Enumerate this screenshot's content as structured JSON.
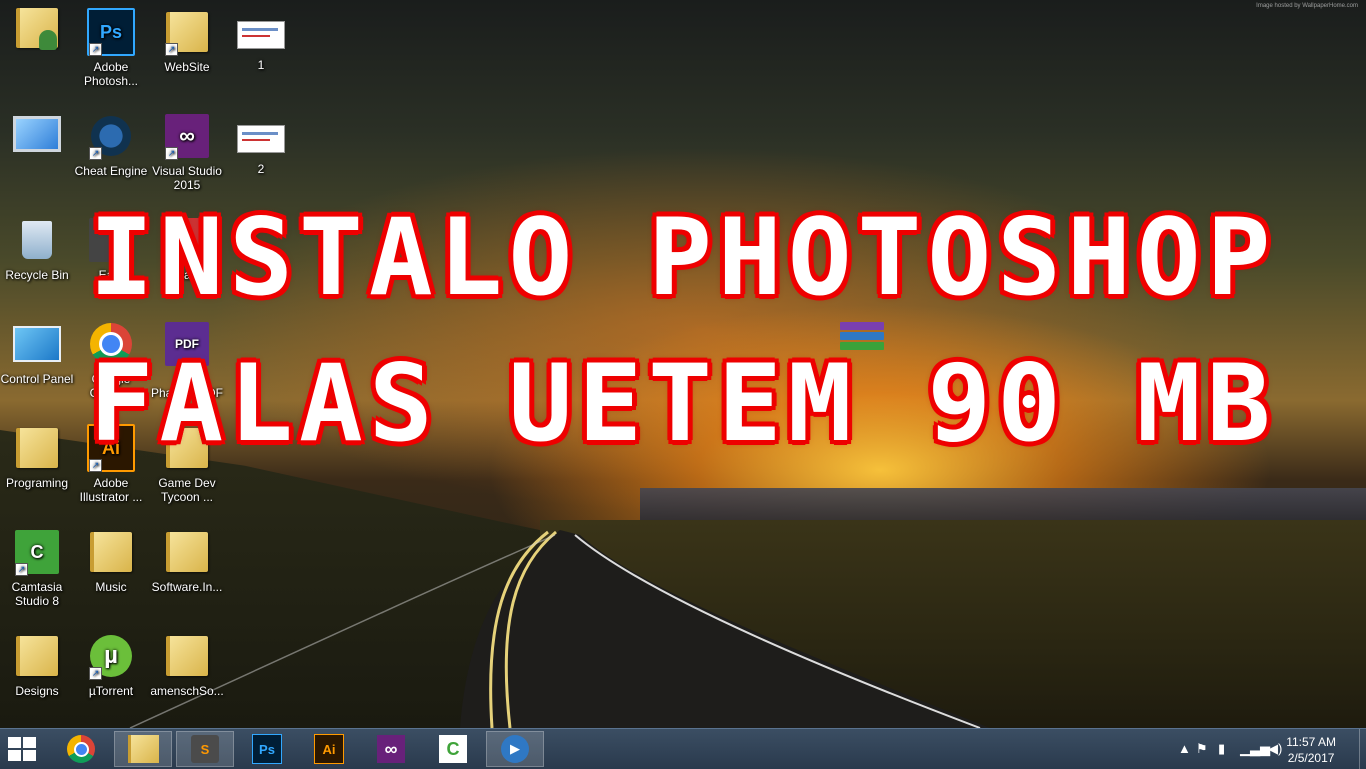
{
  "watermark": "Image hosted by WallpaperHome.com",
  "overlay": {
    "line1": "INSTALO PHOTOSHOP",
    "line2": "FALAS UETEM 90 MB"
  },
  "icons": [
    {
      "label": "",
      "kind": "user-folder"
    },
    {
      "label": "Adobe Photosh...",
      "kind": "ps"
    },
    {
      "label": "WebSite",
      "kind": "folder"
    },
    {
      "label": "1",
      "kind": "thumb"
    },
    {
      "label": "",
      "kind": "computer"
    },
    {
      "label": "Cheat Engine",
      "kind": "cheat"
    },
    {
      "label": "Visual Studio 2015",
      "kind": "vs"
    },
    {
      "label": "2",
      "kind": "thumb"
    },
    {
      "label": "Recycle Bin",
      "kind": "recycle"
    },
    {
      "label": "Ea...",
      "kind": "generic"
    },
    {
      "label": "Cleaner",
      "kind": "generic"
    },
    {
      "label": "Control Panel",
      "kind": "control"
    },
    {
      "label": "Google Chrome",
      "kind": "chrome"
    },
    {
      "label": "Foxit PhantomPDF",
      "kind": "pdf"
    },
    {
      "label": "Programing",
      "kind": "folder"
    },
    {
      "label": "Adobe Illustrator ...",
      "kind": "ai"
    },
    {
      "label": "Game Dev Tycoon ...",
      "kind": "folder"
    },
    {
      "label": "Camtasia Studio 8",
      "kind": "camtasia"
    },
    {
      "label": "Music",
      "kind": "folder"
    },
    {
      "label": "Software.In...",
      "kind": "folder"
    },
    {
      "label": "Designs",
      "kind": "folder"
    },
    {
      "label": "µTorrent",
      "kind": "utorrent"
    },
    {
      "label": "amenschSo...",
      "kind": "folder"
    }
  ],
  "taskbar": {
    "apps": [
      {
        "name": "chrome",
        "glyph": ""
      },
      {
        "name": "file-explorer",
        "glyph": ""
      },
      {
        "name": "sublime",
        "glyph": "S"
      },
      {
        "name": "photoshop",
        "glyph": "Ps"
      },
      {
        "name": "illustrator",
        "glyph": "Ai"
      },
      {
        "name": "visual-studio",
        "glyph": ""
      },
      {
        "name": "camtasia",
        "glyph": "C"
      },
      {
        "name": "media-player",
        "glyph": ""
      }
    ],
    "clock": {
      "time": "11:57 AM",
      "date": "2/5/2017"
    }
  },
  "colors": {
    "overlay_stroke": "#e00000",
    "taskbar": "#2f4056",
    "ps": "#001e36",
    "ai": "#2b1700"
  }
}
